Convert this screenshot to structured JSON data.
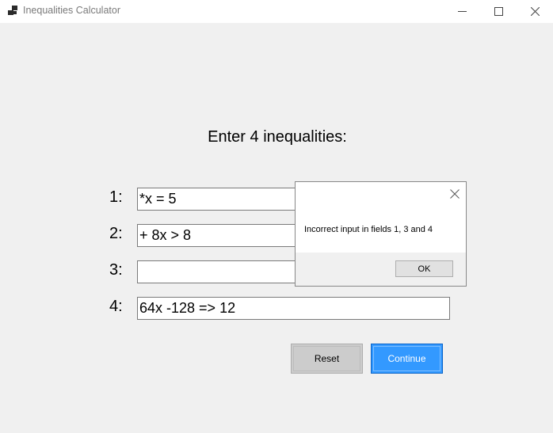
{
  "window": {
    "title": "Inequalities Calculator",
    "icon": "app-icon",
    "controls": [
      "minimize-icon",
      "maximize-icon",
      "close-icon"
    ]
  },
  "main": {
    "heading": "Enter 4 inequalities:",
    "rows": [
      {
        "label": "1:",
        "value": "*x = 5"
      },
      {
        "label": "2:",
        "value": "+ 8x > 8"
      },
      {
        "label": "3:",
        "value": ""
      },
      {
        "label": "4:",
        "value": "64x -128 => 12"
      }
    ],
    "reset_label": "Reset",
    "continue_label": "Continue"
  },
  "dialog": {
    "message": "Incorrect input in fields 1, 3 and 4",
    "ok_label": "OK"
  },
  "colors": {
    "background": "#f0f0f0",
    "accent": "#3399ff",
    "reset_button": "#cccccc"
  }
}
